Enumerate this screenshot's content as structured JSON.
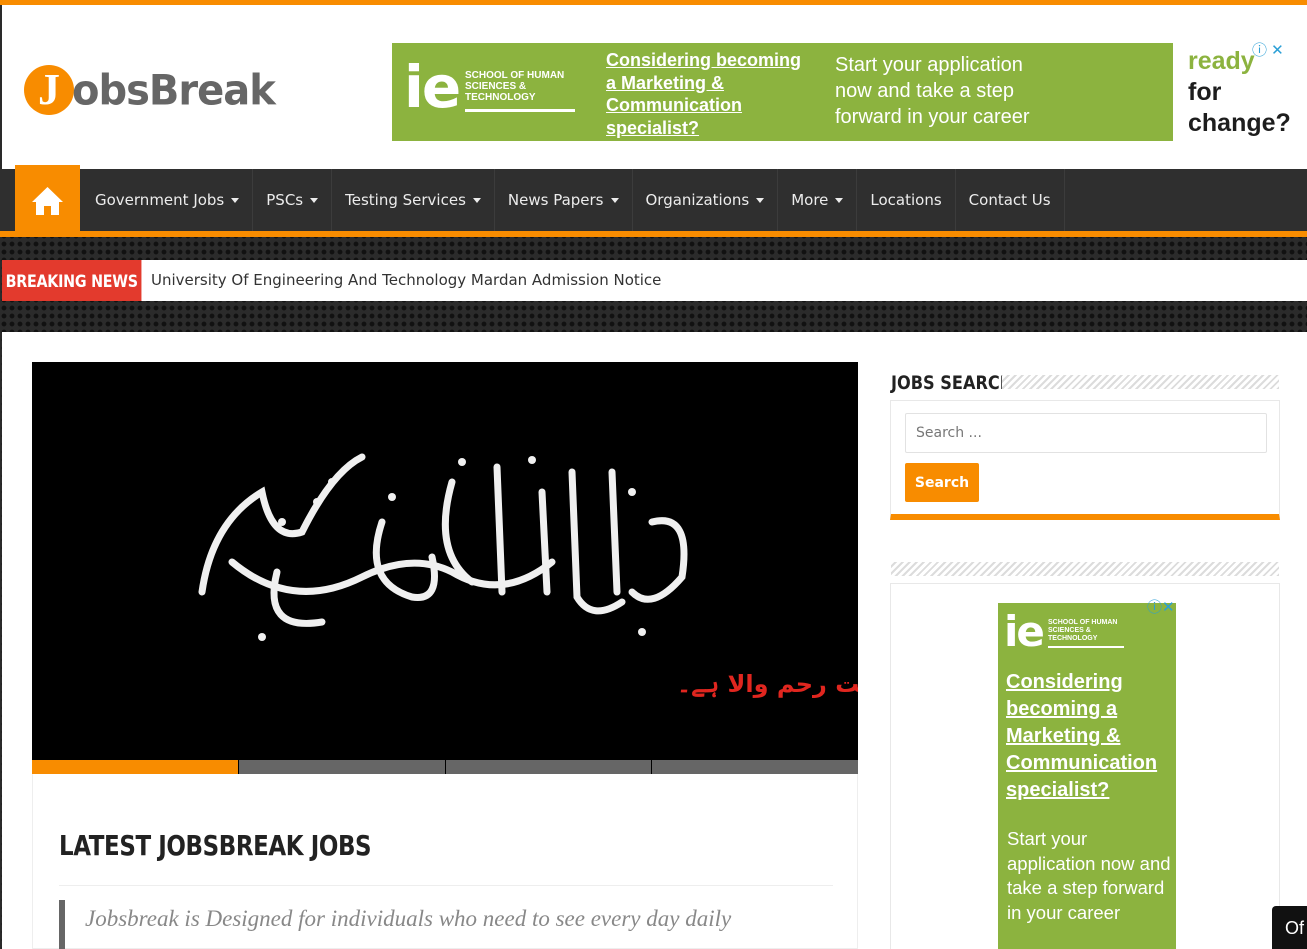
{
  "site": {
    "logo_letter": "J",
    "logo_text": "obsBreak",
    "accent_color": "#f88c00"
  },
  "header_ad": {
    "ie_logo": "ie",
    "school": "SCHOOL OF HUMAN SCIENCES & TECHNOLOGY",
    "headline": "Considering becoming a Marketing & Communication specialist?",
    "body": "Start your application now and take a step forward in your career",
    "side_ready": "ready",
    "side_rest": "for change?",
    "brand_color": "#8cb33f"
  },
  "nav": {
    "home_icon": "home-icon",
    "items": [
      {
        "label": "Government Jobs",
        "dropdown": true
      },
      {
        "label": "PSCs",
        "dropdown": true
      },
      {
        "label": "Testing Services",
        "dropdown": true
      },
      {
        "label": "News Papers",
        "dropdown": true
      },
      {
        "label": "Organizations",
        "dropdown": true
      },
      {
        "label": "More",
        "dropdown": true
      },
      {
        "label": "Locations",
        "dropdown": false
      },
      {
        "label": "Contact Us",
        "dropdown": false
      }
    ]
  },
  "breaking": {
    "label": "BREAKING NEWS",
    "headline": "University Of Engineering And Technology Mardan Admission Notice"
  },
  "slider": {
    "urdu_caption": "شروع اللہ کے نام سے جو بڑا مہربان نہایت رحم والا ہے۔",
    "slide_count": 4,
    "active_slide": 1
  },
  "main": {
    "section_title": "LATEST JOBSBREAK JOBS",
    "intro": "Jobsbreak is Designed for individuals who need to see every day daily"
  },
  "sidebar": {
    "search_title": "JOBS SEARCH",
    "search_placeholder": "Search ...",
    "search_button": "Search",
    "ad": {
      "ie_logo": "ie",
      "school": "SCHOOL OF HUMAN SCIENCES & TECHNOLOGY",
      "headline": "Considering becoming a Marketing & Communication specialist?",
      "body": "Start your application now and take a step forward in your career"
    }
  },
  "corner_button": "Of"
}
